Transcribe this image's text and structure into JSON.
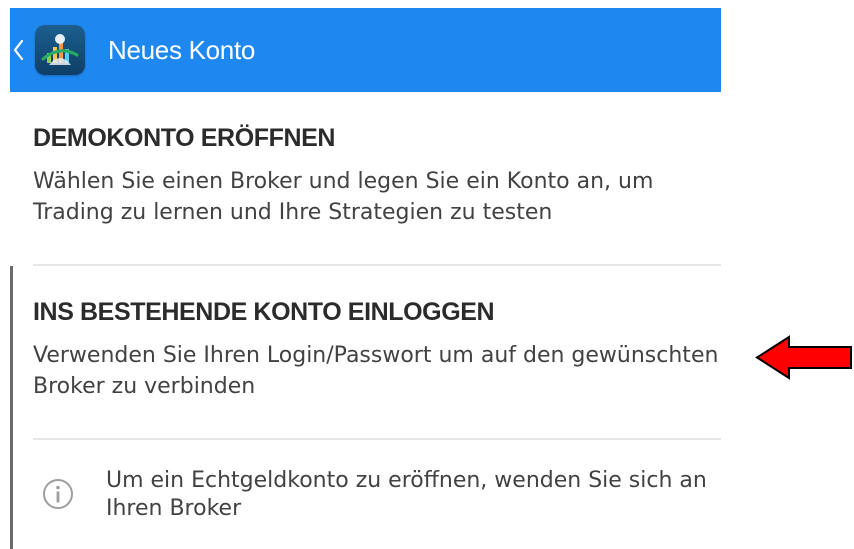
{
  "appbar": {
    "title": "Neues Konto",
    "background": "#1e88f0",
    "back_icon": "chevron-left-icon",
    "app_icon": "metatrader-app-icon"
  },
  "options": [
    {
      "title": "DEMOKONTO ERÖFFNEN",
      "description": "Wählen Sie einen Broker und legen Sie ein Konto an, um Trading zu lernen und Ihre Strategien zu testen"
    },
    {
      "title": "INS BESTEHENDE KONTO EINLOGGEN",
      "description": "Verwenden Sie Ihren Login/Passwort um auf den gewünschten Broker zu verbinden"
    }
  ],
  "info": {
    "icon": "info-icon",
    "text": "Um ein Echtgeldkonto zu eröffnen, wenden Sie sich an Ihren Broker"
  },
  "annotation": {
    "icon": "red-arrow-left-icon",
    "color": "#ff0000"
  }
}
